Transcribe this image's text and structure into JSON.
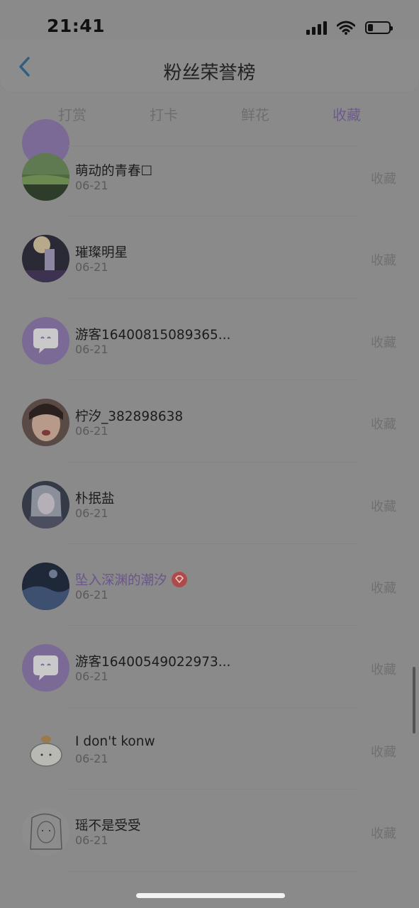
{
  "status_bar": {
    "time": "21:41"
  },
  "header": {
    "title": "粉丝荣誉榜"
  },
  "tabs": [
    {
      "label": "打赏"
    },
    {
      "label": "打卡"
    },
    {
      "label": "鲜花"
    },
    {
      "label": "收藏",
      "active": true
    }
  ],
  "rows": [
    {
      "name": "萌动的青春☐",
      "date": "06-21",
      "action": "收藏",
      "avatar": "green-landscape"
    },
    {
      "name": "璀璨明星",
      "date": "06-21",
      "action": "收藏",
      "avatar": "stage-light"
    },
    {
      "name": "游客1640081508936​5...",
      "date": "06-21",
      "action": "收藏",
      "avatar": "default-chat"
    },
    {
      "name": "柠汐_382898638",
      "date": "06-21",
      "action": "收藏",
      "avatar": "girl-photo"
    },
    {
      "name": "朴抿盐",
      "date": "06-21",
      "action": "收藏",
      "avatar": "anime-girl"
    },
    {
      "name": "坠入深渊的潮汐",
      "date": "06-21",
      "action": "收藏",
      "avatar": "ocean-night",
      "vip": true
    },
    {
      "name": "游客16400549022973...",
      "date": "06-21",
      "action": "收藏",
      "avatar": "default-chat"
    },
    {
      "name": "I don't konw",
      "date": "06-21",
      "action": "收藏",
      "avatar": "cartoon-cat"
    },
    {
      "name": "瑶不是受受",
      "date": "06-21",
      "action": "收藏",
      "avatar": "sketch"
    }
  ],
  "colors": {
    "accent": "#6d5a8c",
    "badge": "#b04a4a",
    "overlay": "#8a8a8a"
  }
}
